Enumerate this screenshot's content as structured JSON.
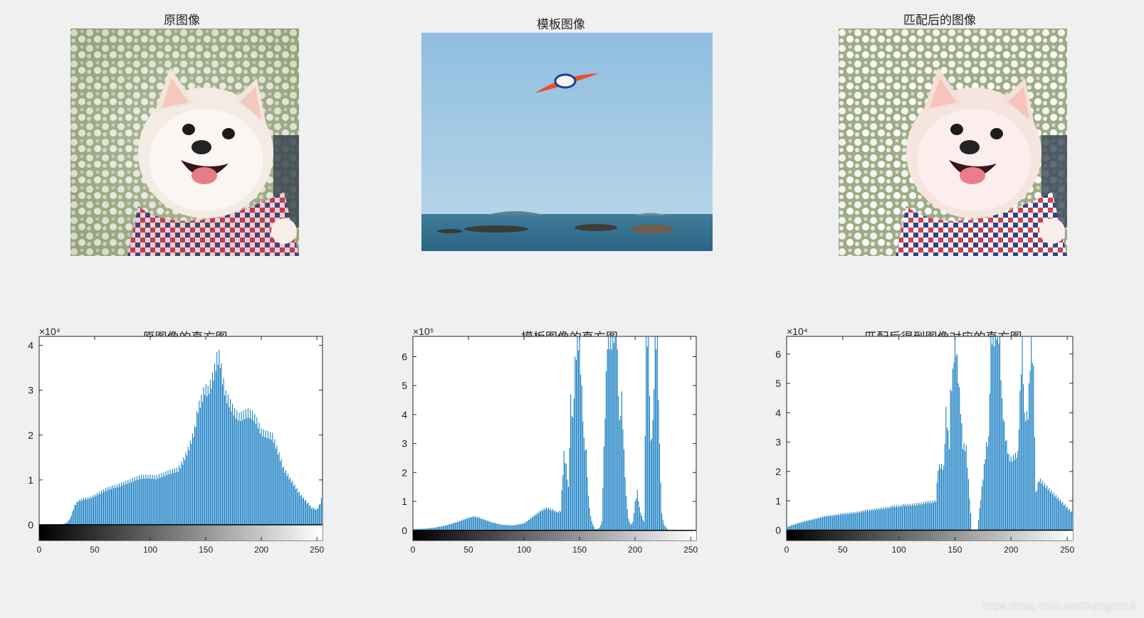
{
  "titles": {
    "original": "原图像",
    "template": "模板图像",
    "matched": "匹配后的图像",
    "hist_original": "原图像的直方图",
    "hist_template": "模板图像的直方图",
    "hist_matched": "匹配后得到图像对应的直方图"
  },
  "watermark": "https://blog.csdn.net/Dujing2019",
  "bar_color": "#0072bd",
  "chart_data": [
    {
      "type": "bar",
      "title": "原图像的直方图",
      "exponent_label": "×10⁴",
      "scale": 10000,
      "xlim": [
        0,
        255
      ],
      "ylim": [
        -0.35,
        4.2
      ],
      "xticks": [
        0,
        50,
        100,
        150,
        200,
        250
      ],
      "yticks": [
        0,
        1,
        2,
        3,
        4
      ],
      "colorbar": true,
      "series": [
        {
          "x": [
            20,
            25,
            28,
            30,
            32,
            35,
            40,
            45,
            50,
            55,
            60,
            65,
            70,
            75,
            80,
            85,
            90,
            95,
            100,
            105,
            110,
            115,
            120,
            125,
            130,
            135,
            140,
            143,
            146,
            149,
            152,
            155,
            158,
            160,
            162,
            163,
            165,
            168,
            170,
            173,
            176,
            180,
            184,
            188,
            192,
            196,
            200,
            205,
            210,
            215,
            220,
            225,
            230,
            235,
            240,
            245,
            250,
            253,
            255
          ],
          "y": [
            0,
            0.05,
            0.15,
            0.3,
            0.45,
            0.55,
            0.6,
            0.62,
            0.68,
            0.75,
            0.82,
            0.87,
            0.9,
            0.95,
            1.0,
            1.05,
            1.1,
            1.12,
            1.12,
            1.1,
            1.15,
            1.2,
            1.25,
            1.28,
            1.5,
            1.8,
            2.2,
            2.7,
            2.9,
            3.15,
            3.1,
            3.3,
            3.6,
            3.85,
            3.9,
            3.8,
            3.4,
            3.0,
            2.9,
            2.75,
            2.6,
            2.5,
            2.55,
            2.6,
            2.55,
            2.4,
            2.15,
            2.1,
            2.05,
            1.7,
            1.3,
            1.1,
            0.9,
            0.7,
            0.55,
            0.4,
            0.35,
            0.5,
            0.7
          ]
        }
      ]
    },
    {
      "type": "bar",
      "title": "模板图像的直方图",
      "exponent_label": "×10⁵",
      "scale": 100000,
      "xlim": [
        0,
        255
      ],
      "ylim": [
        -0.35,
        6.7
      ],
      "xticks": [
        0,
        50,
        100,
        150,
        200,
        250
      ],
      "yticks": [
        0,
        1,
        2,
        3,
        4,
        5,
        6
      ],
      "colorbar": true,
      "series": [
        {
          "x": [
            0,
            10,
            20,
            30,
            40,
            50,
            55,
            60,
            70,
            80,
            90,
            100,
            110,
            115,
            120,
            125,
            130,
            133,
            136,
            138,
            140,
            142,
            144,
            146,
            148,
            150,
            152,
            154,
            156,
            158,
            160,
            162,
            164,
            166,
            168,
            170,
            175,
            180,
            183,
            186,
            188,
            190,
            192,
            194,
            196,
            198,
            200,
            202,
            204,
            206,
            208,
            210,
            212,
            214,
            216,
            218,
            220,
            222,
            224,
            226,
            230,
            240,
            250,
            255
          ],
          "y": [
            0.05,
            0.06,
            0.1,
            0.18,
            0.3,
            0.45,
            0.5,
            0.45,
            0.3,
            0.2,
            0.18,
            0.25,
            0.55,
            0.7,
            0.8,
            0.75,
            0.65,
            0.7,
            2.75,
            2.3,
            1.5,
            4.7,
            3.9,
            6.0,
            6.8,
            6.7,
            5.0,
            3.2,
            2.8,
            1.2,
            0.5,
            0.2,
            0.05,
            0.05,
            0.1,
            0.3,
            6.8,
            6.8,
            7.5,
            3.8,
            4.8,
            2.8,
            1.2,
            0.4,
            0.2,
            0.3,
            1.0,
            1.4,
            0.8,
            0.5,
            0.3,
            6.8,
            7.0,
            3.1,
            3.8,
            6.8,
            6.8,
            3.0,
            0.6,
            0.2,
            0,
            0,
            0,
            0
          ]
        }
      ]
    },
    {
      "type": "bar",
      "title": "匹配后得到图像对应的直方图",
      "exponent_label": "×10⁴",
      "scale": 10000,
      "xlim": [
        0,
        255
      ],
      "ylim": [
        -0.35,
        6.6
      ],
      "xticks": [
        0,
        50,
        100,
        150,
        200,
        250
      ],
      "yticks": [
        0,
        1,
        2,
        3,
        4,
        5,
        6
      ],
      "colorbar": true,
      "series": [
        {
          "x": [
            0,
            5,
            10,
            15,
            20,
            25,
            30,
            35,
            40,
            45,
            50,
            55,
            60,
            65,
            70,
            75,
            80,
            85,
            90,
            95,
            100,
            105,
            110,
            115,
            120,
            125,
            130,
            133,
            135,
            137,
            140,
            142,
            145,
            146,
            148,
            150,
            152,
            155,
            157,
            160,
            165,
            170,
            178,
            180,
            182,
            185,
            188,
            190,
            192,
            195,
            198,
            200,
            203,
            206,
            210,
            212,
            215,
            218,
            220,
            222,
            225,
            255
          ],
          "y": [
            0.1,
            0.18,
            0.25,
            0.3,
            0.35,
            0.4,
            0.45,
            0.5,
            0.52,
            0.55,
            0.58,
            0.6,
            0.62,
            0.65,
            0.7,
            0.72,
            0.75,
            0.78,
            0.8,
            0.85,
            0.85,
            0.9,
            0.9,
            0.92,
            0.95,
            1.0,
            1.0,
            1.05,
            2.2,
            2.3,
            2.2,
            4.2,
            3.0,
            4.8,
            5.5,
            6.9,
            6.0,
            4.3,
            3.0,
            2.9,
            0,
            0,
            3.0,
            3.2,
            6.9,
            6.8,
            7.2,
            6.6,
            4.5,
            3.3,
            2.6,
            2.5,
            2.6,
            2.7,
            6.8,
            4.0,
            4.1,
            6.8,
            5.6,
            1.3,
            1.8,
            0.6
          ]
        }
      ]
    }
  ]
}
